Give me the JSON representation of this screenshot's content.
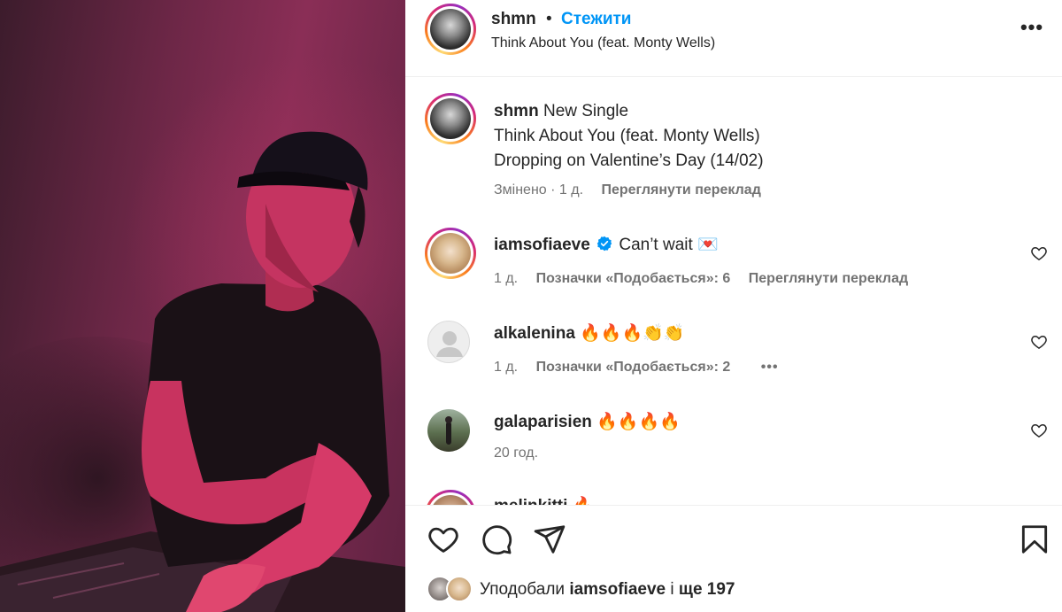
{
  "header": {
    "username": "shmn",
    "separator": "•",
    "follow_label": "Стежити",
    "audio_title": "Think About You (feat. Monty Wells)",
    "more_label": "•••"
  },
  "caption": {
    "username": "shmn",
    "lines": [
      "New Single",
      "Think About You (feat. Monty Wells)",
      "Dropping on Valentine’s Day (14/02)"
    ],
    "edited": "Змінено · 1 д.",
    "translate_label": "Переглянути переклад"
  },
  "comments": [
    {
      "username": "iamsofiaeve",
      "verified": true,
      "text": "Can’t wait 💌",
      "age": "1 д.",
      "likes_label": "Позначки «Подобається»: 6",
      "translate_label": "Переглянути переклад"
    },
    {
      "username": "alkalenina",
      "text": "🔥🔥🔥👏👏",
      "age": "1 д.",
      "likes_label": "Позначки «Подобається»: 2",
      "more_label": "•••"
    },
    {
      "username": "galaparisien",
      "text": "🔥🔥🔥🔥",
      "age": "20 год."
    },
    {
      "username": "melinkitti",
      "text": "🔥"
    }
  ],
  "likes": {
    "prefix": "Уподобали",
    "user": "iamsofiaeve",
    "connector": "і",
    "rest": "ще 197"
  },
  "colors": {
    "link": "#0095f6",
    "meta": "#737373",
    "text": "#262626"
  }
}
